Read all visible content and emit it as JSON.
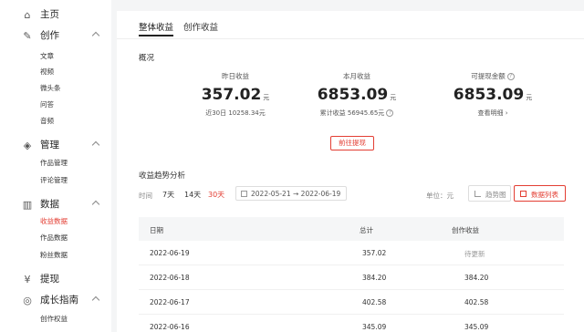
{
  "sidebar": {
    "home": {
      "label": "主页",
      "icon": "home-icon"
    },
    "create": {
      "label": "创作",
      "icon": "edit-icon",
      "items": [
        "文章",
        "视频",
        "微头条",
        "问答",
        "音频"
      ]
    },
    "manage": {
      "label": "管理",
      "icon": "layers-icon",
      "items": [
        "作品管理",
        "评论管理"
      ]
    },
    "data": {
      "label": "数据",
      "icon": "chart-icon",
      "items": [
        "收益数据",
        "作品数据",
        "粉丝数据"
      ],
      "active_item": "收益数据"
    },
    "withdraw": {
      "label": "提现",
      "icon": "money-icon"
    },
    "growth": {
      "label": "成长指南",
      "icon": "compass-icon",
      "items": [
        "创作权益"
      ]
    }
  },
  "tabs": [
    "整体收益",
    "创作收益"
  ],
  "overview": {
    "title": "概况",
    "yesterday": {
      "label": "昨日收益",
      "value": "357.02",
      "unit": "元",
      "sub": "近30日 10258.34元"
    },
    "month": {
      "label": "本月收益",
      "value": "6853.09",
      "unit": "元",
      "sub": "累计收益 56945.65元"
    },
    "available": {
      "label": "可提现金额",
      "value": "6853.09",
      "unit": "元",
      "sub": "查看明细 ›"
    },
    "withdraw_button": "前往提现"
  },
  "trend": {
    "title": "收益趋势分析",
    "time_label": "时间",
    "ranges": [
      "7天",
      "14天",
      "30天"
    ],
    "active_range": "30天",
    "date_start": "2022-05-21",
    "date_sep": "→",
    "date_end": "2022-06-19",
    "unit_label": "单位：元",
    "view_trend": "趋势图",
    "view_list": "数据列表"
  },
  "table": {
    "columns": [
      "日期",
      "总计",
      "创作收益"
    ],
    "rows": [
      {
        "date": "2022-06-19",
        "total": "357.02",
        "creation": "待更新"
      },
      {
        "date": "2022-06-18",
        "total": "384.20",
        "creation": "384.20"
      },
      {
        "date": "2022-06-17",
        "total": "402.58",
        "creation": "402.58"
      },
      {
        "date": "2022-06-16",
        "total": "345.09",
        "creation": "345.09"
      }
    ]
  },
  "colors": {
    "accent": "#e33e33",
    "background": "#f4f5f6",
    "panel": "#ffffff"
  }
}
